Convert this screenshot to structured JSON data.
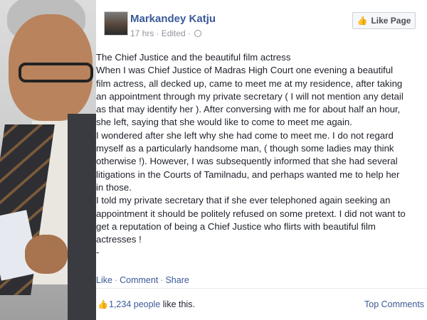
{
  "post": {
    "author": "Markandey Katju",
    "time": "17 hrs",
    "edited": "· Edited ·",
    "like_page_label": "Like Page",
    "body_lines": [
      "The Chief Justice and the beautiful film actress",
      "When I was Chief Justice of Madras High Court one evening a beautiful",
      "film actress, all decked up, came to meet me at my residence, after taking",
      "an appointment through my private secretary ( I will not mention any detail",
      "as that may identify her ). After conversing with me for about half an hour,",
      "she left, saying that she would like to come to meet me again.",
      "I wondered after she left why she had come to meet me. I do not regard",
      "myself as a particularly handsome man, ( though some ladies may think",
      "otherwise !). However, I was subsequently informed that she had several",
      "litigations in the Courts of Tamilnadu, and perhaps wanted me to help her",
      "in those.",
      "I told my private secretary that if she ever telephoned again seeking an",
      "appointment it should be politely refused on some pretext. I did not want to",
      "get a reputation of being a Chief Justice who flirts with beautiful film",
      "actresses !"
    ],
    "trailing_mark": "-",
    "actions": {
      "like": "Like",
      "comment": "Comment",
      "share": "Share",
      "sep": "·"
    },
    "likes": {
      "count": "1,234 people",
      "suffix": " like this."
    },
    "top_comments": "Top Comments"
  },
  "icons": {
    "like_page": "thumbs-up-icon",
    "globe": "globe-icon",
    "likes": "like-icon"
  },
  "colors": {
    "link": "#3b5998",
    "meta": "#90949c",
    "text": "#1d2129"
  }
}
